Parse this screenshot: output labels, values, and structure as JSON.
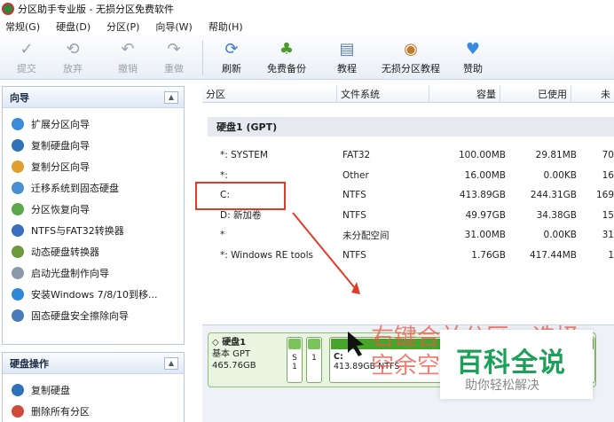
{
  "window": {
    "title": "分区助手专业版 - 无损分区免费软件"
  },
  "menu": [
    "常规(G)",
    "硬盘(D)",
    "分区(P)",
    "向导(W)",
    "帮助(H)"
  ],
  "toolbar": {
    "commit": "提交",
    "discard": "放弃",
    "undo": "撤销",
    "redo": "重做",
    "refresh": "刷新",
    "backup": "免费备份",
    "tutorial": "教程",
    "partition_tutorial": "无损分区教程",
    "sponsor": "赞助"
  },
  "sidebar": {
    "wizard_title": "向导",
    "wizard_items": [
      "扩展分区向导",
      "复制硬盘向导",
      "复制分区向导",
      "迁移系统到固态硬盘",
      "分区恢复向导",
      "NTFS与FAT32转换器",
      "动态硬盘转换器",
      "启动光盘制作向导",
      "安装Windows 7/8/10到移...",
      "固态硬盘安全擦除向导"
    ],
    "disk_ops_title": "硬盘操作",
    "disk_ops_items": [
      "复制硬盘",
      "删除所有分区"
    ]
  },
  "columns": {
    "partition": "分区",
    "filesystem": "文件系统",
    "capacity": "容量",
    "used": "已使用",
    "unused": "未"
  },
  "disk": {
    "label": "硬盘1 (GPT)"
  },
  "partitions": [
    {
      "name": "*: SYSTEM",
      "fs": "FAT32",
      "capacity": "100.00MB",
      "used": "29.81MB",
      "free": "70"
    },
    {
      "name": "*:",
      "fs": "Other",
      "capacity": "16.00MB",
      "used": "0.00KB",
      "free": "16"
    },
    {
      "name": "C:",
      "fs": "NTFS",
      "capacity": "413.89GB",
      "used": "244.31GB",
      "free": "169"
    },
    {
      "name": "D: 新加卷",
      "fs": "NTFS",
      "capacity": "49.97GB",
      "used": "34.38GB",
      "free": "15"
    },
    {
      "name": "*",
      "fs": "未分配空间",
      "capacity": "31.00MB",
      "used": "0.00KB",
      "free": "31"
    },
    {
      "name": "*: Windows RE tools",
      "fs": "NTFS",
      "capacity": "1.76GB",
      "used": "417.44MB",
      "free": "1"
    }
  ],
  "diskmap": {
    "name": "硬盘1",
    "type": "基本 GPT",
    "size": "465.76GB",
    "small_parts": [
      {
        "top": "S",
        "bottom": "1"
      },
      {
        "top": "",
        "bottom": "1"
      }
    ],
    "c_label": "C:",
    "c_detail": "413.89GB NTFS"
  },
  "annotation": {
    "line1": "右键合并分区，选择",
    "line2": "空余空"
  },
  "watermark": {
    "title": "百科全说",
    "subtitle": "助你轻松解决"
  },
  "colors": {
    "highlight": "#e23a2a",
    "annotation": "#e8584a",
    "watermark_green": "#1da05a",
    "bar_green": "#46a52a"
  }
}
